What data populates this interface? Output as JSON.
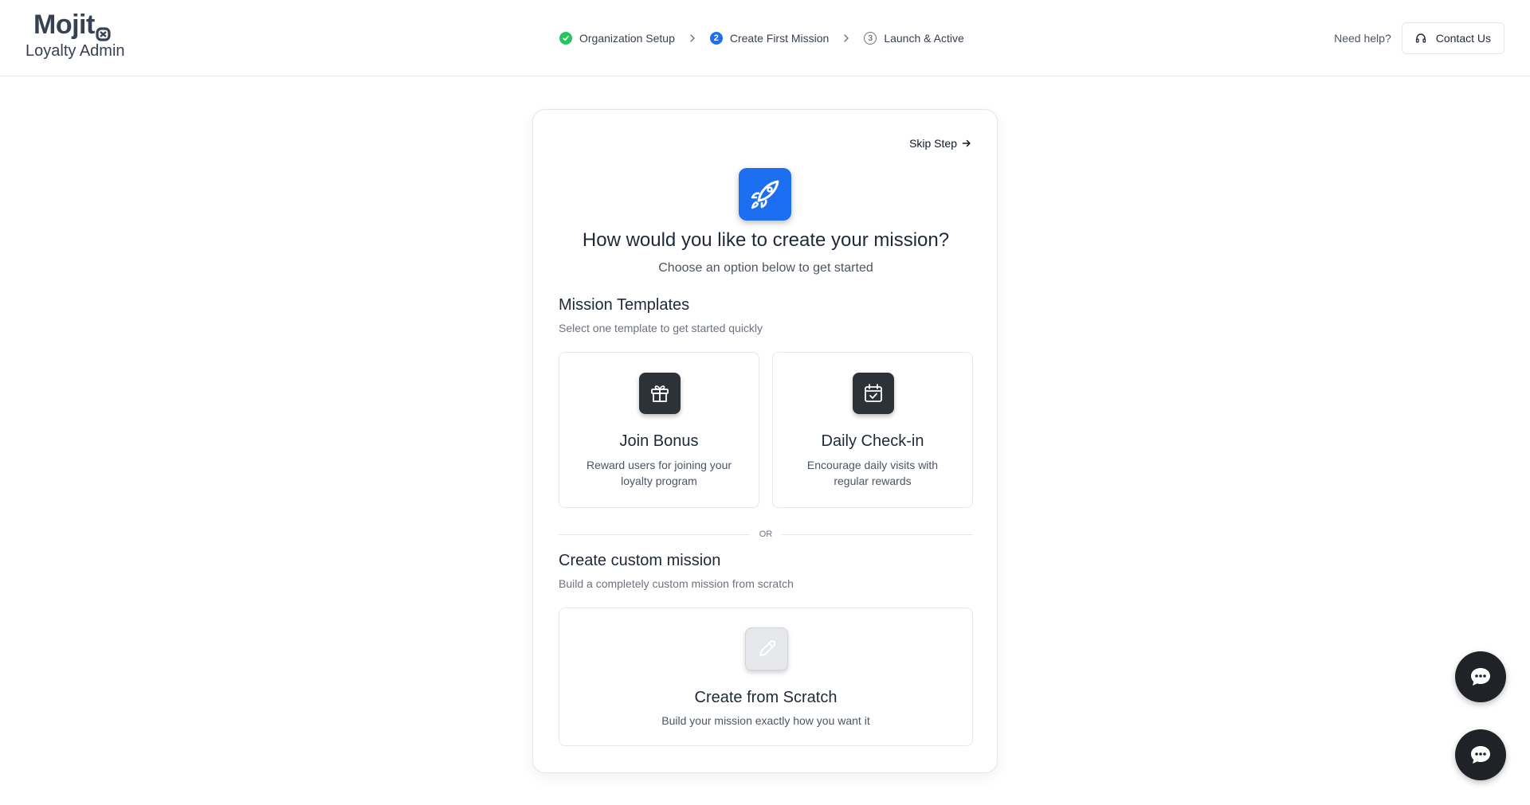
{
  "brand": {
    "logo": "Mojit",
    "subtitle": "Loyalty Admin"
  },
  "stepper": {
    "steps": [
      {
        "label": "Organization Setup",
        "state": "completed"
      },
      {
        "label": "Create First Mission",
        "number": "2",
        "state": "active"
      },
      {
        "label": "Launch & Active",
        "number": "3",
        "state": "pending"
      }
    ]
  },
  "help": {
    "text": "Need help?",
    "contact_label": "Contact Us"
  },
  "card": {
    "skip_label": "Skip Step",
    "title": "How would you like to create your mission?",
    "subtitle": "Choose an option below to get started",
    "templates": {
      "title": "Mission Templates",
      "description": "Select one template to get started quickly",
      "items": [
        {
          "name": "Join Bonus",
          "description": "Reward users for joining your loyalty program",
          "icon": "gift-icon"
        },
        {
          "name": "Daily Check-in",
          "description": "Encourage daily visits with regular rewards",
          "icon": "calendar-check-icon"
        }
      ]
    },
    "divider": "OR",
    "custom": {
      "title": "Create custom mission",
      "description": "Build a completely custom mission from scratch",
      "option_name": "Create from Scratch",
      "option_description": "Build your mission exactly how you want it",
      "icon": "pencil-icon"
    }
  },
  "colors": {
    "primary": "#1d6ff2",
    "success": "#22c55e",
    "dark": "#2d3239"
  }
}
